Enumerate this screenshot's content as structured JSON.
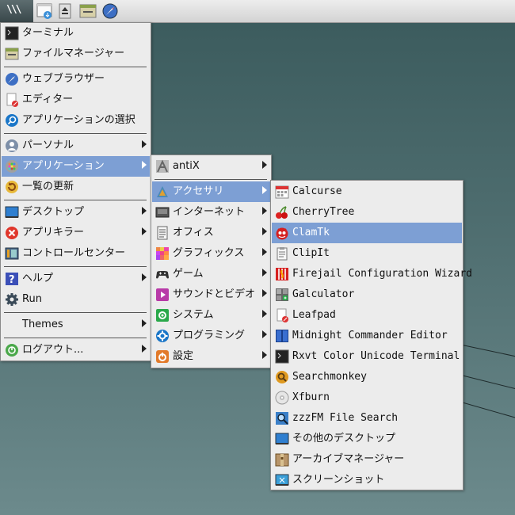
{
  "taskbar": {
    "start_label": "\\\\\\",
    "icons": [
      "files-icon",
      "eject-icon",
      "file-manager-icon",
      "browser-icon"
    ]
  },
  "main_menu": {
    "items": [
      {
        "label": "ターミナル",
        "icon": "terminal-icon"
      },
      {
        "label": "ファイルマネージャー",
        "icon": "file-manager-icon"
      },
      {
        "label": "ウェブブラウザー",
        "icon": "browser-icon"
      },
      {
        "label": "エディター",
        "icon": "editor-icon"
      },
      {
        "label": "アプリケーションの選択",
        "icon": "search-icon"
      },
      {
        "label": "パーソナル",
        "icon": "personal-icon",
        "submenu": true
      },
      {
        "label": "アプリケーション",
        "icon": "applications-icon",
        "submenu": true,
        "highlighted": true
      },
      {
        "label": "一覧の更新",
        "icon": "refresh-icon"
      },
      {
        "label": "デスクトップ",
        "icon": "desktop-icon",
        "submenu": true
      },
      {
        "label": "アプリキラー",
        "icon": "kill-icon",
        "submenu": true
      },
      {
        "label": "コントロールセンター",
        "icon": "control-center-icon"
      },
      {
        "label": "ヘルプ",
        "icon": "help-icon",
        "submenu": true
      },
      {
        "label": "Run",
        "icon": "gear-icon"
      },
      {
        "label": "Themes",
        "icon": "",
        "submenu": true
      },
      {
        "label": "ログアウト...",
        "icon": "logout-icon",
        "submenu": true
      }
    ]
  },
  "app_menu": {
    "items": [
      {
        "label": "antiX",
        "icon": "antix-icon",
        "submenu": true
      },
      {
        "label": "アクセサリ",
        "icon": "accessories-icon",
        "submenu": true,
        "highlighted": true
      },
      {
        "label": "インターネット",
        "icon": "internet-icon",
        "submenu": true
      },
      {
        "label": "オフィス",
        "icon": "office-icon",
        "submenu": true
      },
      {
        "label": "グラフィックス",
        "icon": "graphics-icon",
        "submenu": true
      },
      {
        "label": "ゲーム",
        "icon": "gamepad-icon",
        "submenu": true
      },
      {
        "label": "サウンドとビデオ",
        "icon": "multimedia-icon",
        "submenu": true
      },
      {
        "label": "システム",
        "icon": "system-icon",
        "submenu": true
      },
      {
        "label": "プログラミング",
        "icon": "programming-icon",
        "submenu": true
      },
      {
        "label": "設定",
        "icon": "settings-icon",
        "submenu": true
      }
    ]
  },
  "accessories_menu": {
    "items": [
      {
        "label": "Calcurse",
        "icon": "calendar-icon"
      },
      {
        "label": "CherryTree",
        "icon": "cherry-icon"
      },
      {
        "label": "ClamTk",
        "icon": "clamtk-icon",
        "highlighted": true
      },
      {
        "label": "ClipIt",
        "icon": "clipboard-icon"
      },
      {
        "label": "Firejail Configuration Wizard",
        "icon": "firejail-icon"
      },
      {
        "label": "Galculator",
        "icon": "calculator-icon"
      },
      {
        "label": "Leafpad",
        "icon": "leafpad-icon"
      },
      {
        "label": "Midnight Commander Editor",
        "icon": "mc-icon"
      },
      {
        "label": "Rxvt Color Unicode Terminal",
        "icon": "terminal-icon"
      },
      {
        "label": "Searchmonkey",
        "icon": "searchmonkey-icon"
      },
      {
        "label": "Xfburn",
        "icon": "disc-icon"
      },
      {
        "label": "zzzFM File Search",
        "icon": "file-search-icon"
      },
      {
        "label": "その他のデスクトップ",
        "icon": "desktop-icon"
      },
      {
        "label": "アーカイブマネージャー",
        "icon": "archive-icon"
      },
      {
        "label": "スクリーンショット",
        "icon": "screenshot-icon"
      }
    ]
  }
}
